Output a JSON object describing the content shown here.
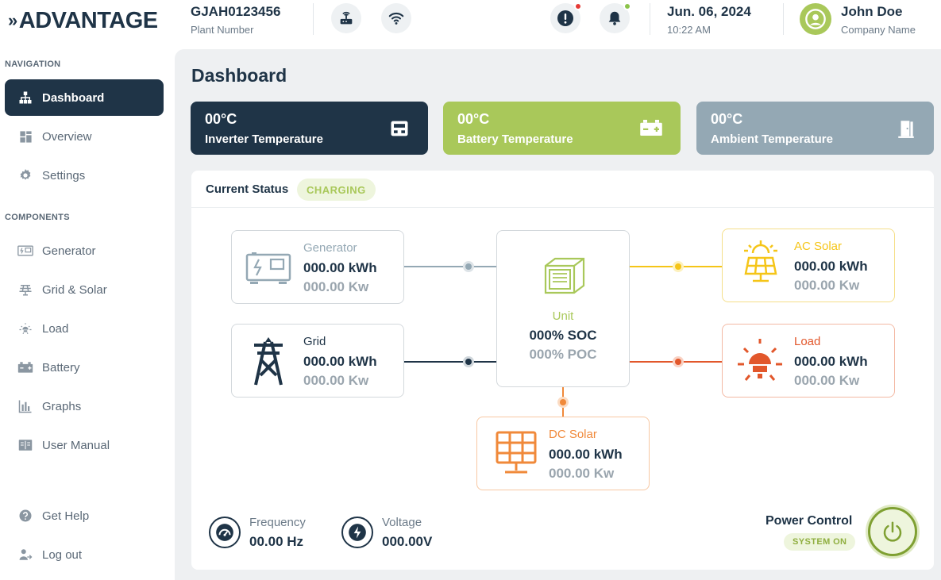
{
  "app": {
    "logo": "ADVANTAGE"
  },
  "header": {
    "plant_number": "GJAH0123456",
    "plant_label": "Plant Number",
    "date": "Jun. 06, 2024",
    "time": "10:22 AM",
    "user_name": "John Doe",
    "company": "Company Name",
    "icons": [
      "router-icon",
      "wifi-icon",
      "alert-icon",
      "bell-icon",
      "user-avatar-icon"
    ]
  },
  "sidebar": {
    "nav_heading": "NAVIGATION",
    "nav_items": [
      {
        "label": "Dashboard",
        "icon": "sitemap-icon",
        "active": true
      },
      {
        "label": "Overview",
        "icon": "grid-icon"
      },
      {
        "label": "Settings",
        "icon": "gear-icon"
      }
    ],
    "components_heading": "COMPONENTS",
    "component_items": [
      {
        "label": "Generator",
        "icon": "generator-icon"
      },
      {
        "label": "Grid & Solar",
        "icon": "solar-panel-icon"
      },
      {
        "label": "Load",
        "icon": "bulb-icon"
      },
      {
        "label": "Battery",
        "icon": "battery-icon"
      },
      {
        "label": "Graphs",
        "icon": "bar-chart-icon"
      },
      {
        "label": "User Manual",
        "icon": "book-icon"
      }
    ],
    "footer_items": [
      {
        "label": "Get Help",
        "icon": "help-icon"
      },
      {
        "label": "Log out",
        "icon": "logout-icon"
      }
    ]
  },
  "main": {
    "title": "Dashboard",
    "temperatures": [
      {
        "value": "00°C",
        "label": "Inverter Temperature",
        "color": "#1f3447",
        "icon": "inverter-icon"
      },
      {
        "value": "00°C",
        "label": "Battery Temperature",
        "color": "#a9c85a",
        "icon": "battery-icon"
      },
      {
        "value": "00°C",
        "label": "Ambient Temperature",
        "color": "#94a8b4",
        "icon": "door-icon"
      }
    ],
    "status": {
      "label": "Current Status",
      "value": "CHARGING"
    },
    "nodes": {
      "generator": {
        "title": "Generator",
        "energy": "000.00 kWh",
        "power": "000.00 Kw",
        "color": "#94a8b4"
      },
      "grid": {
        "title": "Grid",
        "energy": "000.00 kWh",
        "power": "000.00 Kw",
        "color": "#1f3447"
      },
      "unit": {
        "title": "Unit",
        "soc": "000% SOC",
        "poc": "000% POC",
        "color": "#a9c85a"
      },
      "ac_solar": {
        "title": "AC Solar",
        "energy": "000.00 kWh",
        "power": "000.00 Kw",
        "color": "#f5c518"
      },
      "load": {
        "title": "Load",
        "energy": "000.00 kWh",
        "power": "000.00 Kw",
        "color": "#e2572b"
      },
      "dc_solar": {
        "title": "DC Solar",
        "energy": "000.00 kWh",
        "power": "000.00 Kw",
        "color": "#f0893a"
      }
    },
    "frequency": {
      "label": "Frequency",
      "value": "00.00 Hz"
    },
    "voltage": {
      "label": "Voltage",
      "value": "000.00V"
    },
    "power_control": {
      "label": "Power Control",
      "status": "SYSTEM ON"
    }
  }
}
